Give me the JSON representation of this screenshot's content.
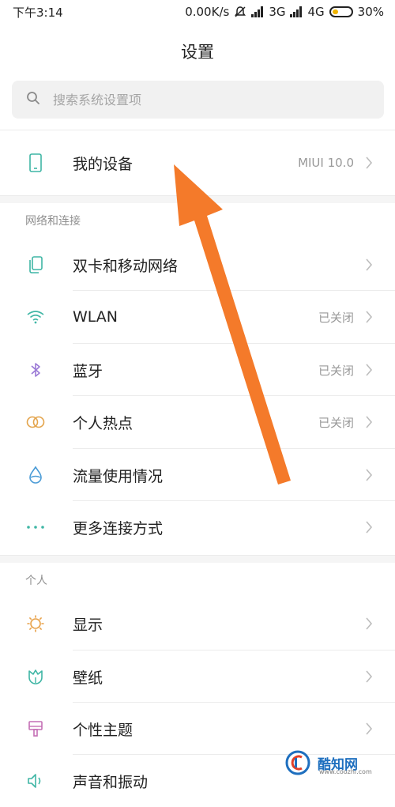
{
  "status_bar": {
    "time": "下午3:14",
    "net_speed": "0.00K/s",
    "network_3g": "3G",
    "network_4g": "4G",
    "battery_percent": "30%",
    "battery_level": 0.3,
    "battery_color": "#f0b400"
  },
  "header": {
    "title": "设置"
  },
  "search": {
    "placeholder": "搜索系统设置项"
  },
  "my_device": {
    "label": "我的设备",
    "value": "MIUI 10.0",
    "icon": "phone-icon"
  },
  "sections": [
    {
      "title": "网络和连接",
      "items": [
        {
          "label": "双卡和移动网络",
          "value": "",
          "icon": "dual-sim-icon",
          "color": "#3fb6a5"
        },
        {
          "label": "WLAN",
          "value": "已关闭",
          "icon": "wifi-icon",
          "color": "#3fb6a5"
        },
        {
          "label": "蓝牙",
          "value": "已关闭",
          "icon": "bluetooth-icon",
          "color": "#9b7ad6"
        },
        {
          "label": "个人热点",
          "value": "已关闭",
          "icon": "hotspot-icon",
          "color": "#e3a44c"
        },
        {
          "label": "流量使用情况",
          "value": "",
          "icon": "data-usage-icon",
          "color": "#4a9bd6"
        },
        {
          "label": "更多连接方式",
          "value": "",
          "icon": "more-dots-icon",
          "color": "#3fb6a5"
        }
      ]
    },
    {
      "title": "个人",
      "items": [
        {
          "label": "显示",
          "value": "",
          "icon": "sun-icon",
          "color": "#e8a24a"
        },
        {
          "label": "壁纸",
          "value": "",
          "icon": "wallpaper-icon",
          "color": "#3fb6a5"
        },
        {
          "label": "个性主题",
          "value": "",
          "icon": "theme-icon",
          "color": "#c46fb5"
        },
        {
          "label": "声音和振动",
          "value": "",
          "icon": "sound-icon",
          "color": "#3fb6a5"
        }
      ]
    }
  ],
  "annotation": {
    "arrow_color": "#f47a2a"
  },
  "watermark": {
    "text": "酷知网",
    "url": "www.coozhi.com"
  }
}
